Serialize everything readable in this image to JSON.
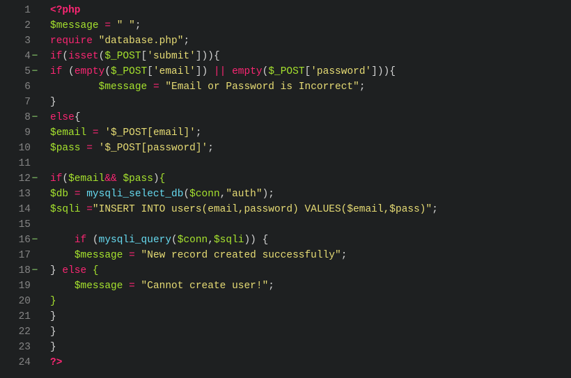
{
  "lines": [
    {
      "num": "1",
      "fold": "",
      "tokens": [
        [
          "tag",
          "<?php"
        ]
      ]
    },
    {
      "num": "2",
      "fold": "",
      "tokens": [
        [
          "var",
          "$message"
        ],
        [
          "punc",
          " "
        ],
        [
          "op",
          "="
        ],
        [
          "punc",
          " "
        ],
        [
          "str",
          "\" \""
        ],
        [
          "punc",
          ";"
        ]
      ]
    },
    {
      "num": "3",
      "fold": "",
      "tokens": [
        [
          "keyword",
          "require"
        ],
        [
          "punc",
          " "
        ],
        [
          "str",
          "\"database.php\""
        ],
        [
          "punc",
          ";"
        ]
      ]
    },
    {
      "num": "4",
      "fold": "−",
      "tokens": [
        [
          "keyword",
          "if"
        ],
        [
          "punc",
          "("
        ],
        [
          "keyword",
          "isset"
        ],
        [
          "punc",
          "("
        ],
        [
          "var",
          "$_POST"
        ],
        [
          "punc",
          "["
        ],
        [
          "str",
          "'submit'"
        ],
        [
          "punc",
          "])){"
        ]
      ]
    },
    {
      "num": "5",
      "fold": "−",
      "tokens": [
        [
          "keyword",
          "if"
        ],
        [
          "punc",
          " ("
        ],
        [
          "keyword",
          "empty"
        ],
        [
          "punc",
          "("
        ],
        [
          "var",
          "$_POST"
        ],
        [
          "punc",
          "["
        ],
        [
          "str",
          "'email'"
        ],
        [
          "punc",
          "]) "
        ],
        [
          "op",
          "||"
        ],
        [
          "punc",
          " "
        ],
        [
          "keyword",
          "empty"
        ],
        [
          "punc",
          "("
        ],
        [
          "var",
          "$_POST"
        ],
        [
          "punc",
          "["
        ],
        [
          "str",
          "'password'"
        ],
        [
          "punc",
          "])){"
        ]
      ]
    },
    {
      "num": "6",
      "fold": "",
      "tokens": [
        [
          "punc",
          "        "
        ],
        [
          "var",
          "$message"
        ],
        [
          "punc",
          " "
        ],
        [
          "op",
          "="
        ],
        [
          "punc",
          " "
        ],
        [
          "str",
          "\"Email or Password is Incorrect\""
        ],
        [
          "punc",
          ";"
        ]
      ]
    },
    {
      "num": "7",
      "fold": "",
      "tokens": [
        [
          "punc",
          "}"
        ]
      ]
    },
    {
      "num": "8",
      "fold": "−",
      "tokens": [
        [
          "keyword",
          "else"
        ],
        [
          "punc",
          "{"
        ]
      ]
    },
    {
      "num": "9",
      "fold": "",
      "tokens": [
        [
          "var",
          "$email"
        ],
        [
          "punc",
          " "
        ],
        [
          "op",
          "="
        ],
        [
          "punc",
          " "
        ],
        [
          "str",
          "'$_POST[email]'"
        ],
        [
          "punc",
          ";"
        ]
      ]
    },
    {
      "num": "10",
      "fold": "",
      "tokens": [
        [
          "var",
          "$pass"
        ],
        [
          "punc",
          " "
        ],
        [
          "op",
          "="
        ],
        [
          "punc",
          " "
        ],
        [
          "str",
          "'$_POST[password]'"
        ],
        [
          "punc",
          ";"
        ]
      ]
    },
    {
      "num": "11",
      "fold": "",
      "tokens": []
    },
    {
      "num": "12",
      "fold": "−",
      "tokens": [
        [
          "keyword",
          "if"
        ],
        [
          "punc",
          "("
        ],
        [
          "var",
          "$email"
        ],
        [
          "op",
          "&&"
        ],
        [
          "punc",
          " "
        ],
        [
          "var",
          "$pass"
        ],
        [
          "punc",
          ")"
        ],
        [
          "brace",
          "{"
        ]
      ]
    },
    {
      "num": "13",
      "fold": "",
      "tokens": [
        [
          "var",
          "$db"
        ],
        [
          "punc",
          " "
        ],
        [
          "op",
          "="
        ],
        [
          "punc",
          " "
        ],
        [
          "func",
          "mysqli_select_db"
        ],
        [
          "punc",
          "("
        ],
        [
          "var",
          "$conn"
        ],
        [
          "punc",
          ","
        ],
        [
          "str",
          "\"auth\""
        ],
        [
          "punc",
          ");"
        ]
      ]
    },
    {
      "num": "14",
      "fold": "",
      "tokens": [
        [
          "var",
          "$sqli"
        ],
        [
          "punc",
          " "
        ],
        [
          "op",
          "="
        ],
        [
          "str",
          "\"INSERT INTO users(email,password) VALUES($email,$pass)\""
        ],
        [
          "punc",
          ";"
        ]
      ]
    },
    {
      "num": "15",
      "fold": "",
      "tokens": []
    },
    {
      "num": "16",
      "fold": "−",
      "tokens": [
        [
          "punc",
          "    "
        ],
        [
          "keyword",
          "if"
        ],
        [
          "punc",
          " ("
        ],
        [
          "func",
          "mysqli_query"
        ],
        [
          "punc",
          "("
        ],
        [
          "var",
          "$conn"
        ],
        [
          "punc",
          ","
        ],
        [
          "var",
          "$sqli"
        ],
        [
          "punc",
          ")) {"
        ]
      ]
    },
    {
      "num": "17",
      "fold": "",
      "tokens": [
        [
          "punc",
          "    "
        ],
        [
          "var",
          "$message"
        ],
        [
          "punc",
          " "
        ],
        [
          "op",
          "="
        ],
        [
          "punc",
          " "
        ],
        [
          "str",
          "\"New record created successfully\""
        ],
        [
          "punc",
          ";"
        ]
      ]
    },
    {
      "num": "18",
      "fold": "−",
      "tokens": [
        [
          "punc",
          "} "
        ],
        [
          "keyword",
          "else"
        ],
        [
          "punc",
          " "
        ],
        [
          "brace",
          "{"
        ]
      ]
    },
    {
      "num": "19",
      "fold": "",
      "tokens": [
        [
          "punc",
          "    "
        ],
        [
          "var",
          "$message"
        ],
        [
          "punc",
          " "
        ],
        [
          "op",
          "="
        ],
        [
          "punc",
          " "
        ],
        [
          "str",
          "\"Cannot create user!\""
        ],
        [
          "punc",
          ";"
        ]
      ]
    },
    {
      "num": "20",
      "fold": "",
      "tokens": [
        [
          "brace",
          "}"
        ]
      ]
    },
    {
      "num": "21",
      "fold": "",
      "tokens": [
        [
          "punc",
          "}"
        ]
      ]
    },
    {
      "num": "22",
      "fold": "",
      "tokens": [
        [
          "punc",
          "}"
        ]
      ]
    },
    {
      "num": "23",
      "fold": "",
      "tokens": [
        [
          "punc",
          "}"
        ]
      ]
    },
    {
      "num": "24",
      "fold": "",
      "tokens": [
        [
          "tag",
          "?>"
        ]
      ]
    }
  ]
}
